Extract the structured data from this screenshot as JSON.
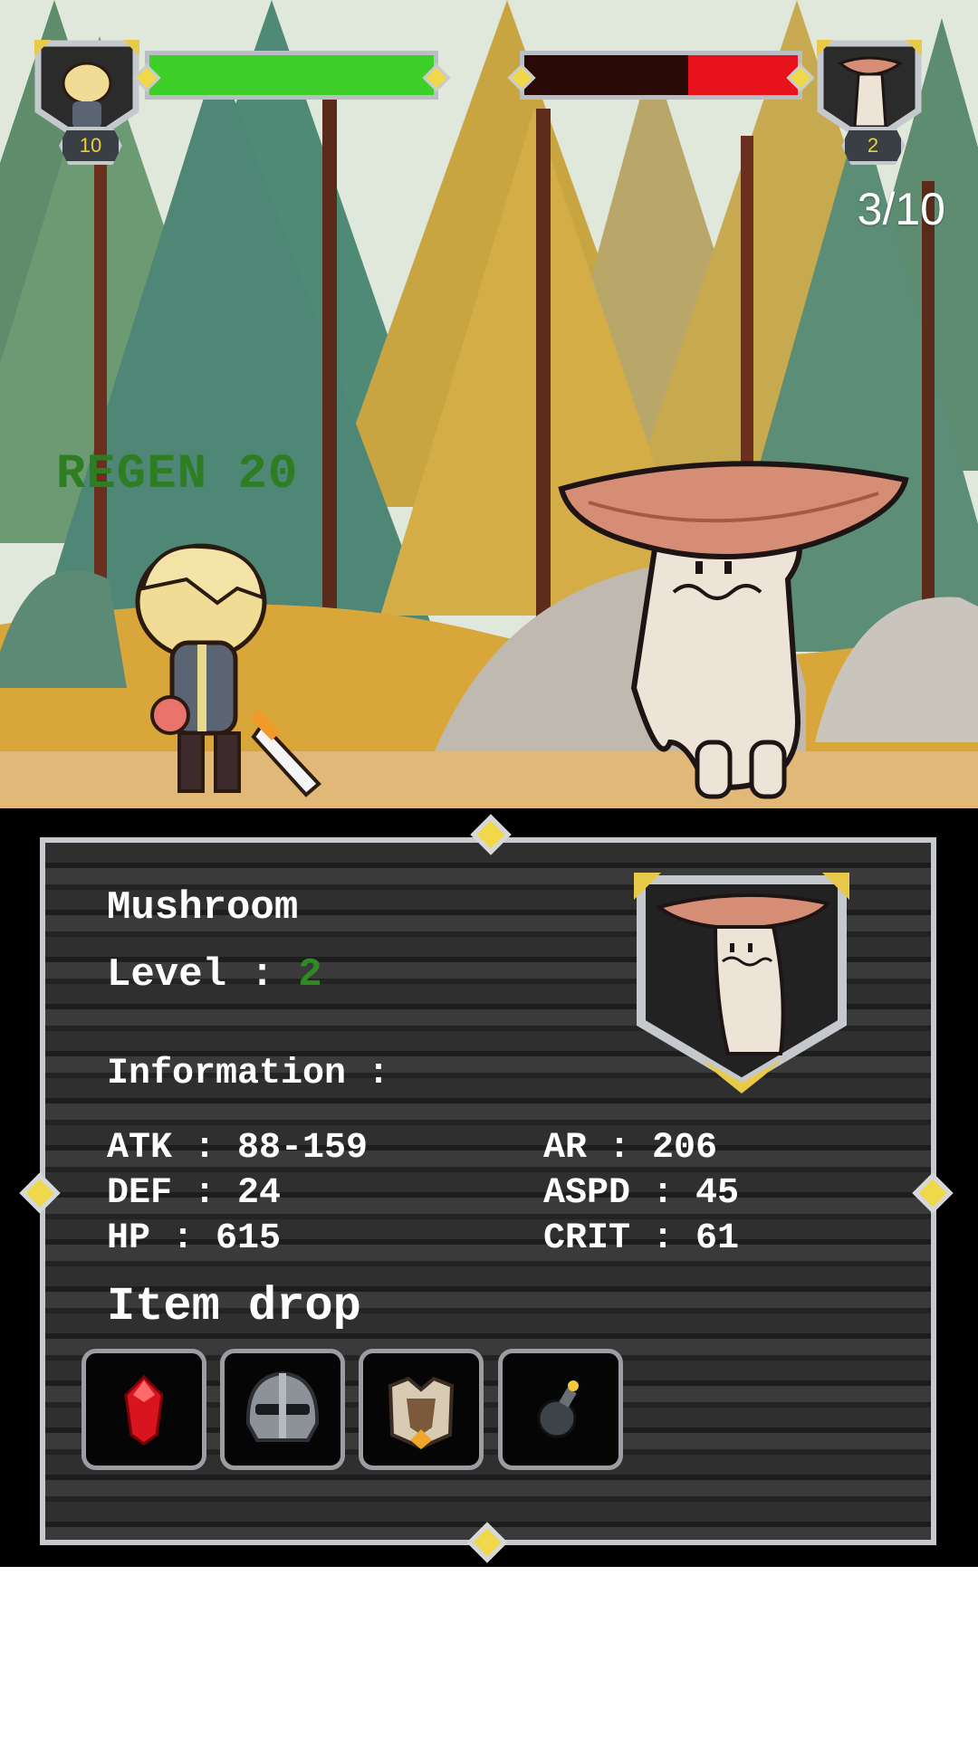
{
  "player": {
    "level_badge": "10",
    "hp_fraction": 1.0,
    "hp_color": "#3fcf2a"
  },
  "enemy": {
    "level_badge": "2",
    "hp_fraction": 0.4,
    "hp_color": "#e8121c"
  },
  "stage_counter": "3/10",
  "floating_text": "REGEN 20",
  "info": {
    "name": "Mushroom",
    "level_label": "Level : ",
    "level_value": "2",
    "information_label": "Information :",
    "stats": {
      "atk": "ATK : 88-159",
      "def": "DEF : 24",
      "hp": "HP : 615",
      "ar": "AR : 206",
      "aspd": "ASPD : 45",
      "crit": "CRIT : 61"
    },
    "item_drop_label": "Item drop",
    "items": [
      {
        "icon": "red-gem-icon"
      },
      {
        "icon": "knight-helmet-icon"
      },
      {
        "icon": "armor-chest-icon"
      },
      {
        "icon": "bomb-potion-icon"
      }
    ]
  },
  "colors": {
    "accent_gold": "#f1d84a",
    "panel_border": "#c6cace",
    "level_green": "#2e8b22"
  }
}
